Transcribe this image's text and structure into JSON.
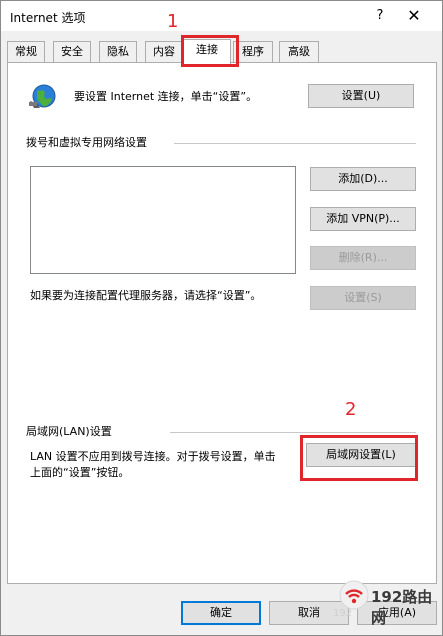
{
  "window": {
    "title": "Internet 选项",
    "help": "?",
    "close": "✕"
  },
  "tabs": [
    {
      "label": "常规"
    },
    {
      "label": "安全"
    },
    {
      "label": "隐私"
    },
    {
      "label": "内容"
    },
    {
      "label": "连接"
    },
    {
      "label": "程序"
    },
    {
      "label": "高级"
    }
  ],
  "active_tab": "连接",
  "setup": {
    "description": "要设置 Internet 连接，单击“设置”。",
    "button": "设置(U)"
  },
  "dialup": {
    "heading": "拨号和虚拟专用网络设置",
    "add": "添加(D)...",
    "add_vpn": "添加 VPN(P)...",
    "remove": "删除(R)...",
    "proxy_hint": "如果要为连接配置代理服务器，请选择“设置”。",
    "settings": "设置(S)"
  },
  "lan": {
    "heading": "局域网(LAN)设置",
    "line1": "LAN 设置不应用到拨号连接。对于拨号设置，单击",
    "line2": "上面的“设置”按钮。",
    "button": "局域网设置(L)"
  },
  "footer": {
    "ok": "确定",
    "cancel": "取消",
    "apply": "应用(A)"
  },
  "annotations": {
    "step1": "1",
    "step2": "2"
  },
  "watermark": {
    "text": "192路由网",
    "small": "192"
  },
  "colors": {
    "annotation_red": "#e0262b",
    "button_face": "#e1e1e1",
    "dialog_bg": "#f0f0f0"
  }
}
